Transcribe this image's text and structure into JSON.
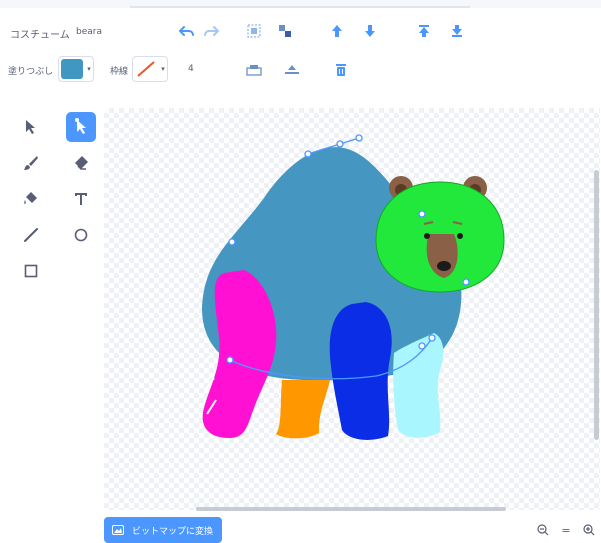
{
  "toolbar": {
    "costume_label": "コスチューム",
    "costume_name": "beara",
    "fill_label": "塗りつぶし",
    "outline_label": "枠線",
    "outline_width": "4"
  },
  "colors": {
    "fill": "#3f97c2",
    "outline": "#e8582a",
    "accent": "#4c97ff",
    "bear_body": "#4597c1",
    "bear_head": "#22e83c",
    "leg_front": "#ff10d2",
    "leg_orange": "#ff9800",
    "leg_blue": "#0b2de6",
    "leg_cyan": "#a9f6ff"
  },
  "icons": {
    "undo": "undo-icon",
    "redo": "redo-icon",
    "group": "group-icon",
    "ungroup": "ungroup-icon",
    "forward": "forward-icon",
    "backward": "backward-icon",
    "front": "front-icon",
    "back": "back-icon",
    "copy": "copy-icon",
    "paste": "paste-icon",
    "delete": "delete-icon"
  },
  "tools": [
    "select",
    "reshape",
    "brush",
    "eraser",
    "fill",
    "text",
    "line",
    "circle",
    "rectangle"
  ],
  "active_tool": "reshape",
  "footer": {
    "bitmap_button": "ビットマップに変換",
    "zoom_out": "−",
    "zoom_reset": "=",
    "zoom_in": "+"
  }
}
